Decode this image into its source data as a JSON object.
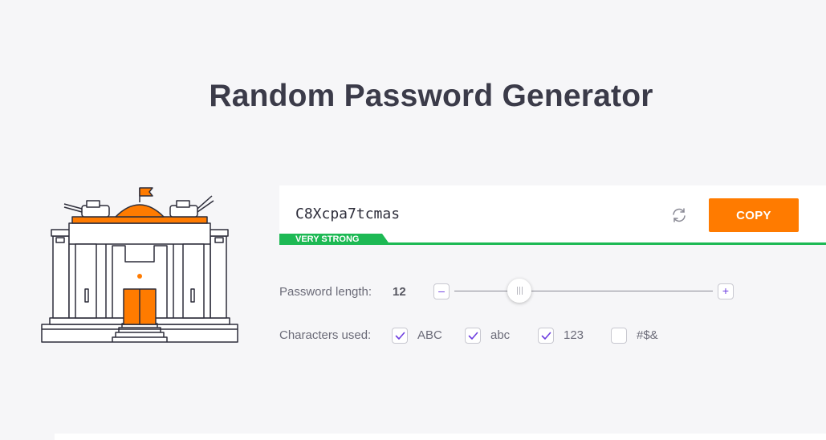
{
  "page": {
    "title": "Random Password Generator"
  },
  "password": {
    "value": "C8Xcpa7tcmas",
    "strength": "VERY STRONG",
    "copy_label": "COPY"
  },
  "length": {
    "label": "Password length:",
    "value": "12",
    "minus": "–",
    "plus": "+"
  },
  "characters": {
    "label": "Characters used:",
    "options": [
      {
        "label": "ABC",
        "checked": true
      },
      {
        "label": "abc",
        "checked": true
      },
      {
        "label": "123",
        "checked": true
      },
      {
        "label": "#$&",
        "checked": false
      }
    ]
  },
  "colors": {
    "accent": "#ff7b00",
    "strength": "#1db954",
    "check": "#6d3de0",
    "title": "#3b3b49"
  },
  "icons": {
    "illustration": "fortress-illustration",
    "refresh": "refresh-icon",
    "checkmark": "checkmark-icon"
  }
}
